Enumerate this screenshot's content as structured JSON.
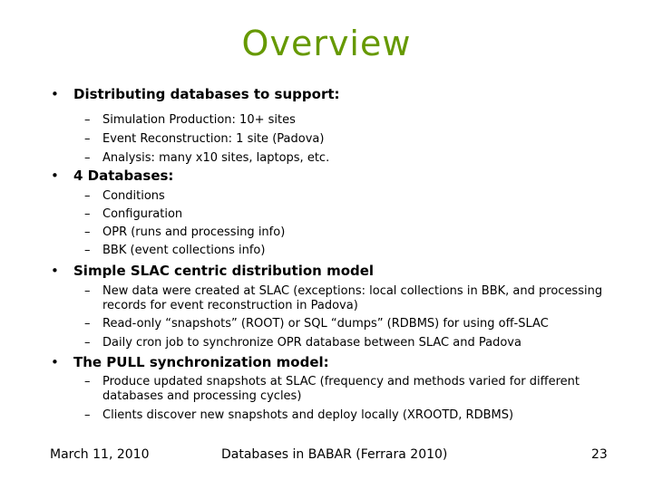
{
  "slide": {
    "title": "Overview",
    "title_color": "#669900",
    "bullets": [
      {
        "text": "Distributing databases to support:",
        "subitems": [
          "Simulation Production: 10+ sites",
          "Event Reconstruction: 1 site (Padova)",
          "Analysis: many x10 sites, laptops, etc."
        ]
      },
      {
        "text": "4 Databases:",
        "subitems": [
          "Conditions",
          "Configuration",
          "OPR (runs and processing info)",
          "BBK (event collections info)"
        ]
      },
      {
        "text": "Simple SLAC centric distribution model",
        "subitems": [
          "New data were created at SLAC (exceptions: local collections in BBK, and processing records for event reconstruction in Padova)",
          "Read-only “snapshots” (ROOT) or SQL “dumps” (RDBMS) for using off-SLAC",
          "Daily cron job to synchronize OPR database between SLAC and Padova"
        ]
      },
      {
        "text": "The PULL synchronization model:",
        "subitems": [
          "Produce updated snapshots at SLAC (frequency and methods varied for different databases and processing cycles)",
          "Clients discover new snapshots and deploy locally (XROOTD, RDBMS)"
        ]
      }
    ],
    "bullet_glyph": "•",
    "dash_glyph": "–"
  },
  "footer": {
    "date": "March 11, 2010",
    "center": "Databases in BABAR (Ferrara 2010)",
    "page_number": "23"
  }
}
